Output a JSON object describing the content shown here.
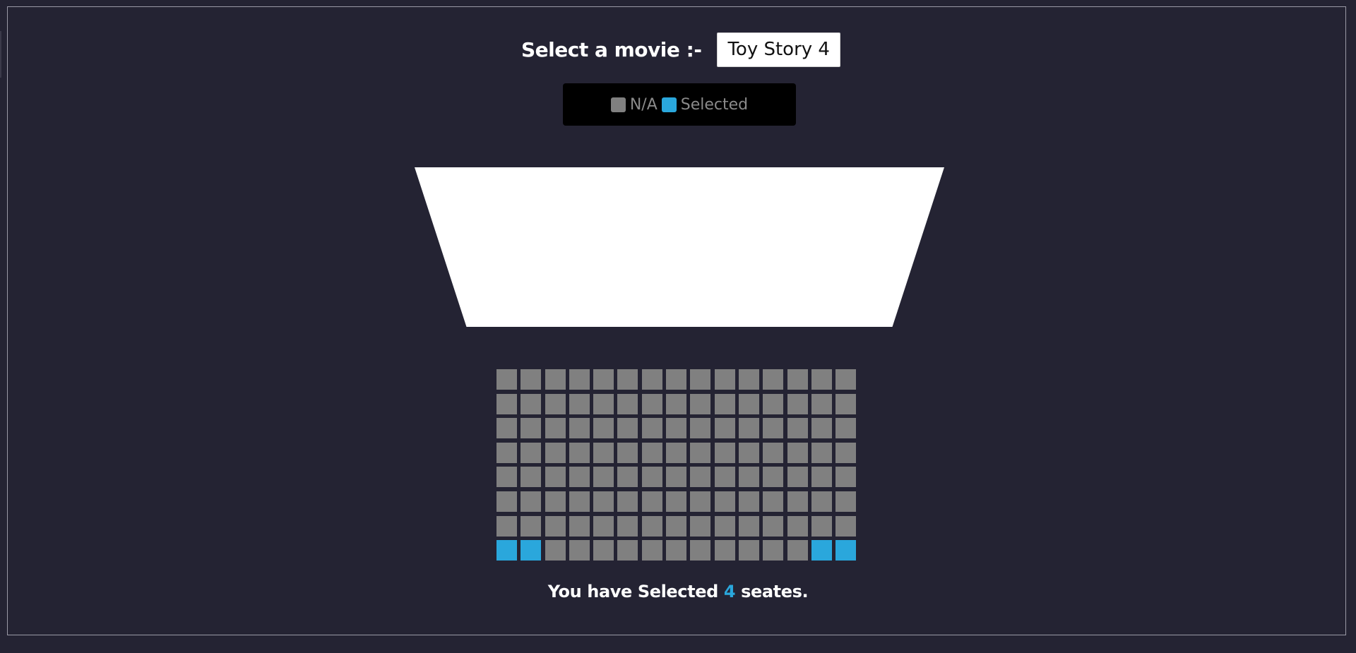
{
  "header": {
    "label": "Select a movie :-",
    "selected_movie": "Toy Story 4"
  },
  "legend": {
    "na_label": "N/A",
    "selected_label": "Selected",
    "na_color": "#808080",
    "selected_color": "#2aa7dc"
  },
  "seat_map": {
    "rows": 8,
    "columns": 15,
    "selected_seats": [
      {
        "row": 8,
        "col": 1
      },
      {
        "row": 8,
        "col": 2
      },
      {
        "row": 8,
        "col": 14
      },
      {
        "row": 8,
        "col": 15
      }
    ]
  },
  "summary": {
    "prefix": "You have Selected",
    "count": "4",
    "suffix": "seates."
  }
}
